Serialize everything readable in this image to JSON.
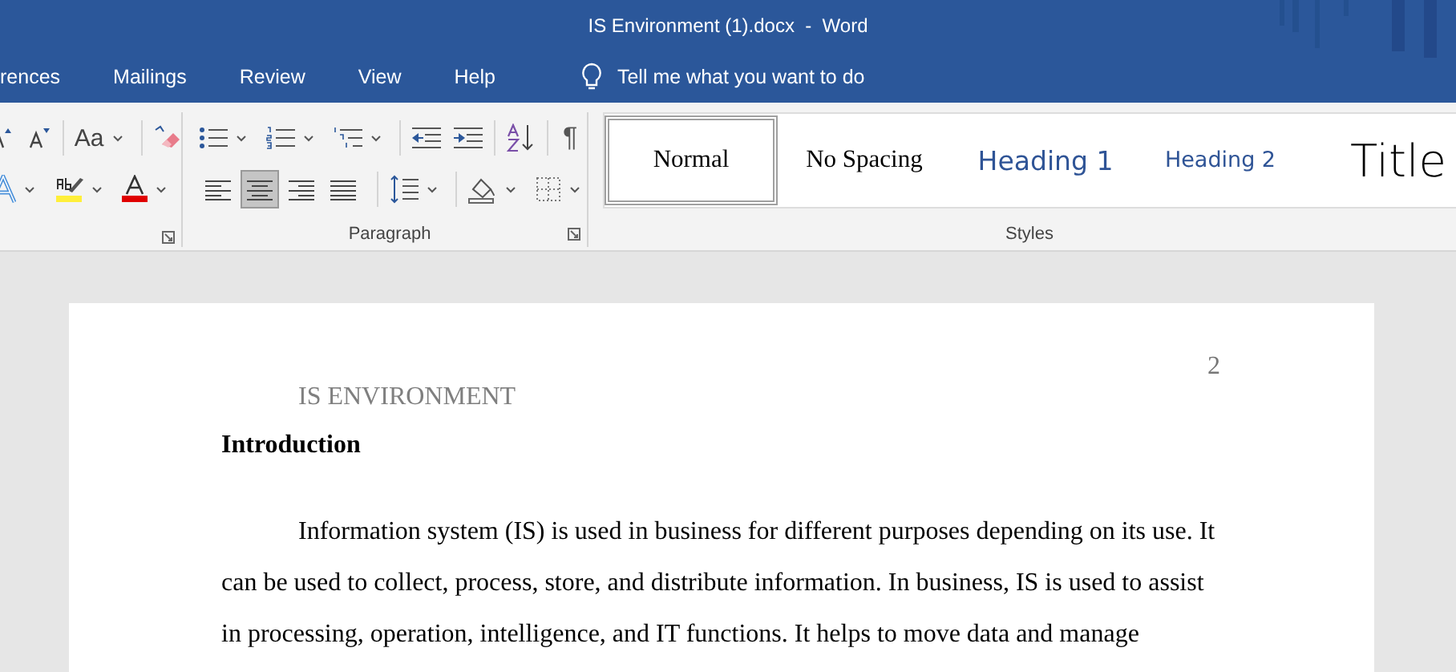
{
  "window": {
    "title": "IS Environment (1).docx  -  Word"
  },
  "tabs": [
    {
      "label": "rences",
      "selected": false
    },
    {
      "label": "Mailings",
      "selected": false
    },
    {
      "label": "Review",
      "selected": false
    },
    {
      "label": "View",
      "selected": false
    },
    {
      "label": "Help",
      "selected": false
    }
  ],
  "tell_me": {
    "placeholder": "Tell me what you want to do"
  },
  "font_group": {
    "change_case": "Aa"
  },
  "paragraph_group": {
    "label": "Paragraph",
    "pilcrow": "¶",
    "alignment": [
      {
        "kind": "left",
        "selected": false
      },
      {
        "kind": "center",
        "selected": true
      },
      {
        "kind": "right",
        "selected": false
      },
      {
        "kind": "justify",
        "selected": false
      }
    ]
  },
  "styles_group": {
    "label": "Styles",
    "styles": [
      {
        "label": "Normal",
        "kind": "normal",
        "selected": true
      },
      {
        "label": "No Spacing",
        "kind": "normal",
        "selected": false
      },
      {
        "label": "Heading 1",
        "kind": "heading1",
        "selected": false
      },
      {
        "label": "Heading 2",
        "kind": "heading2",
        "selected": false
      },
      {
        "label": "Title",
        "kind": "title",
        "selected": false
      }
    ]
  },
  "document": {
    "page_number": "2",
    "running_head": "IS ENVIRONMENT",
    "heading": "Introduction",
    "paragraph_lines": [
      "Information system (IS) is used in business for different purposes depending on its use. It",
      "can be used to collect, process, store, and distribute information. In business, IS is used to assist",
      "in processing, operation, intelligence, and IT functions. It helps to move data and manage"
    ]
  }
}
